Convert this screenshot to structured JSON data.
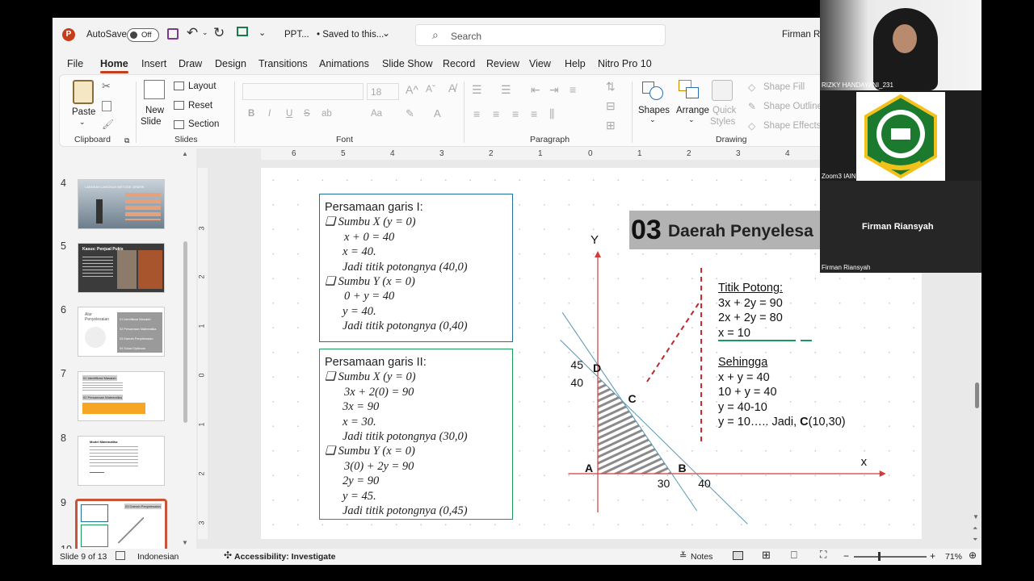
{
  "titlebar": {
    "autosave_label": "AutoSave",
    "autosave_state": "Off",
    "filename": "PPT...",
    "save_status": "• Saved to this...",
    "search_placeholder": "Search",
    "user": "Firman Ri"
  },
  "menu": {
    "tabs": [
      "File",
      "Home",
      "Insert",
      "Draw",
      "Design",
      "Transitions",
      "Animations",
      "Slide Show",
      "Record",
      "Review",
      "View",
      "Help",
      "Nitro Pro 10"
    ]
  },
  "ribbon": {
    "clipboard": {
      "paste": "Paste",
      "label": "Clipboard"
    },
    "slides": {
      "new_slide_1": "New",
      "new_slide_2": "Slide",
      "layout": "Layout",
      "reset": "Reset",
      "section": "Section",
      "label": "Slides"
    },
    "font": {
      "size": "18",
      "bold": "B",
      "italic": "I",
      "underline": "U",
      "strike": "S",
      "shadow": "ab",
      "case": "Aa",
      "label": "Font"
    },
    "paragraph": {
      "label": "Paragraph"
    },
    "drawing": {
      "shapes": "Shapes",
      "arrange": "Arrange",
      "quick_styles_1": "Quick",
      "quick_styles_2": "Styles",
      "shape_fill": "Shape Fill",
      "shape_outline": "Shape Outline",
      "shape_effects": "Shape Effects",
      "label": "Drawing"
    },
    "ruler_ticks": [
      "6",
      "5",
      "4",
      "3",
      "2",
      "1",
      "0",
      "1",
      "2",
      "3",
      "4"
    ]
  },
  "thumbnails": {
    "numbers": [
      "4",
      "5",
      "6",
      "7",
      "8",
      "9",
      "10"
    ],
    "t4_title": "LANGKAH-LANGKAH METODE GRAFIK",
    "t5_title": "Kasus: Penjual Pukis",
    "t6_title": "Alur Penyelesaian",
    "t6_items": [
      "01 Identifikasi Masalah",
      "02 Persamaan Matematika",
      "03 Daerah Penyelesaian",
      "04 Solusi Optimum"
    ],
    "t7_title": "01 Identifikasi Masalah",
    "t7_sub": "02 Persamaan Matematika",
    "t8_title": "Model Matematika",
    "t9_title": "03 Daerah Penyelesaian"
  },
  "vruler_ticks": [
    "3",
    "2",
    "1",
    "0",
    "1",
    "2",
    "3"
  ],
  "slide": {
    "eq1": {
      "title": "Persamaan garis I:",
      "lines": [
        "❑ Sumbu X (y = 0)",
        "x + 0 = 40",
        "x = 40.",
        "Jadi titik potongnya (40,0)",
        "❑ Sumbu Y (x = 0)",
        "0 + y = 40",
        "y = 40.",
        "Jadi titik potongnya (0,40)"
      ]
    },
    "eq2": {
      "title": "Persamaan garis II:",
      "lines": [
        "❑ Sumbu X (y = 0)",
        "3x + 2(0) = 90",
        "3x = 90",
        "x = 30.",
        "Jadi titik potongnya (30,0)",
        "❑ Sumbu Y (x = 0)",
        "3(0) + 2y = 90",
        "2y = 90",
        "y = 45.",
        "Jadi titik potongnya (0,45)"
      ]
    },
    "heading_num": "03",
    "heading_text": "Daerah Penyelesa",
    "titik_potong": [
      "Titik Potong:",
      "3x + 2y = 90",
      "2x + 2y = 80",
      "x = 10"
    ],
    "sehingga": [
      "Sehingga",
      "x + y = 40",
      "10 + y = 40",
      "y = 40-10"
    ],
    "jadi_line": "y = 10….. Jadi,",
    "jadi_point": "C",
    "jadi_coords": "(10,30)"
  },
  "chart_data": {
    "type": "line",
    "x_axis_label": "x",
    "y_axis_label": "Y",
    "point_labels": [
      "A",
      "B",
      "C",
      "D"
    ],
    "tick_labels": {
      "x": [
        "30",
        "40"
      ],
      "y": [
        "45",
        "40"
      ]
    },
    "series": [
      {
        "x": [
          0,
          40
        ],
        "y": [
          40,
          0
        ]
      },
      {
        "x": [
          0,
          30
        ],
        "y": [
          45,
          0
        ]
      }
    ],
    "points": {
      "A": [
        0,
        0
      ],
      "B": [
        30,
        0
      ],
      "C": [
        10,
        30
      ],
      "D": [
        0,
        40
      ]
    },
    "shaded_region": "A-B-C-D",
    "colors": {
      "line1": "#5a96b4",
      "line2": "#5a96b4",
      "axes": "#d33b3b",
      "dash": "#c0272d",
      "shade": "#888888"
    }
  },
  "status": {
    "slide_info": "Slide 9 of 13",
    "language": "Indonesian",
    "accessibility": "Accessibility: Investigate",
    "notes": "Notes",
    "zoom": "71%"
  },
  "video": {
    "p1_name": "RIZKY HANDAYANI_231",
    "p2_name": "Zoom3 IAIN Kendari",
    "p3_label": "Firman Riansyah",
    "p3_name": "Firman Riansyah"
  },
  "colors": {
    "accent": "#c43e1c",
    "box1": "#1f6f99",
    "box2": "#1a9b5c"
  }
}
